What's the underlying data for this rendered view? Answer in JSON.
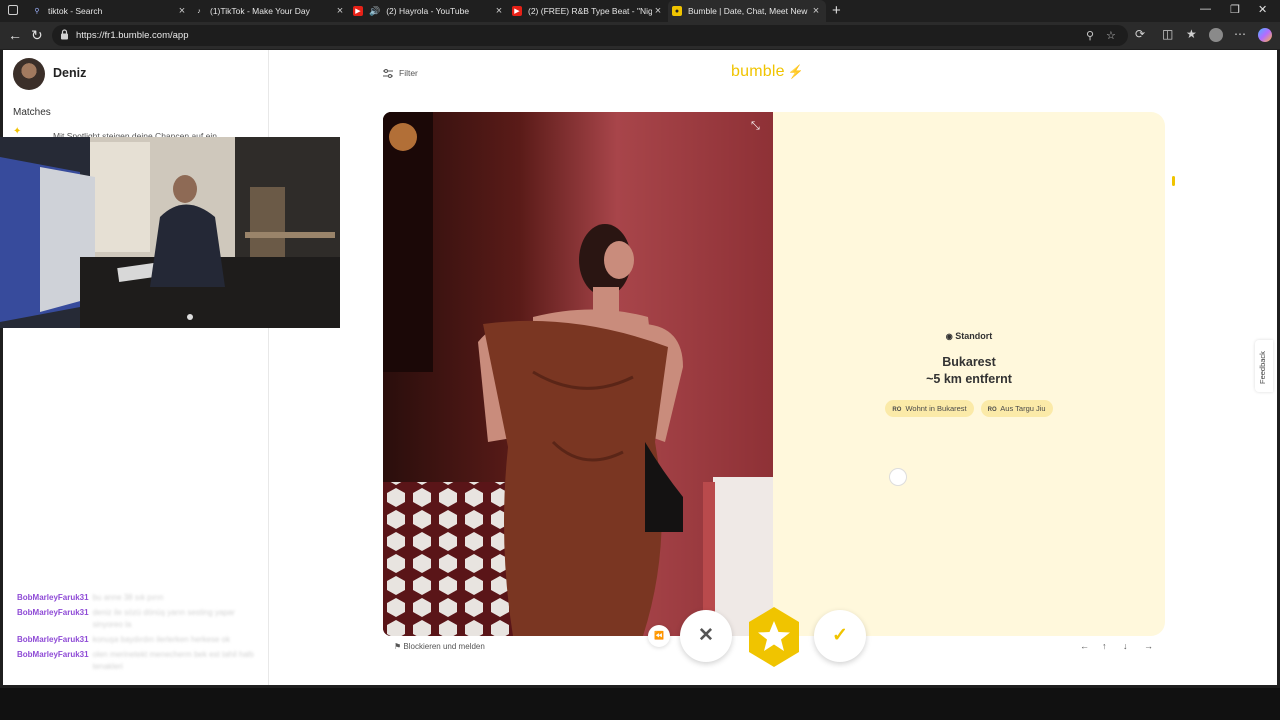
{
  "browser": {
    "tabs": [
      {
        "title": "tiktok - Search",
        "favicon": "search-icon",
        "active": false
      },
      {
        "title": "(1)TikTok - Make Your Day",
        "favicon": "tiktok-icon",
        "active": false
      },
      {
        "title": "(2) Hayrola - YouTube",
        "favicon": "youtube-icon",
        "active": false
      },
      {
        "title": "(2) (FREE) R&B Type Beat - \"Nigh",
        "favicon": "youtube-icon",
        "active": false
      },
      {
        "title": "Bumble | Date, Chat, Meet New P",
        "favicon": "bumble-icon",
        "active": true
      }
    ],
    "url": "https://fr1.bumble.com/app"
  },
  "sidebar": {
    "user_name": "Deniz",
    "matches_label": "Matches",
    "spotlight_text": "Mit Spotlight steigen deine Chancen auf ein"
  },
  "chat": [
    {
      "user": "BobMarleyFaruk31",
      "message": "bu anne 38 sık pırın"
    },
    {
      "user": "BobMarleyFaruk31",
      "message": "deniz ile sözü dönüş yarın sesting yapar sinyoreo la"
    },
    {
      "user": "BobMarleyFaruk31",
      "message": "konuşa baydırdın ilerlerken herkese ok"
    },
    {
      "user": "BobMarleyFaruk31",
      "message": "olen merinetekt menecherm bek est tahil haltı tenakleri"
    }
  ],
  "app": {
    "filter_label": "Filter",
    "logo_text": "bumble",
    "location_label": "Standort",
    "location_city": "Bukarest",
    "location_distance": "~5 km entfernt",
    "pills": [
      {
        "flag": "RO",
        "text": "Wohnt in Bukarest"
      },
      {
        "flag": "RO",
        "text": "Aus Targu Jiu"
      }
    ],
    "report_text": "Blockieren und melden",
    "feedback_label": "Feedback",
    "kbd_hints": [
      "←",
      "↑",
      "↓",
      "→"
    ]
  },
  "colors": {
    "brand": "#f0c400",
    "panel": "#fff8dc",
    "chat_user": "#8f4bd6"
  }
}
